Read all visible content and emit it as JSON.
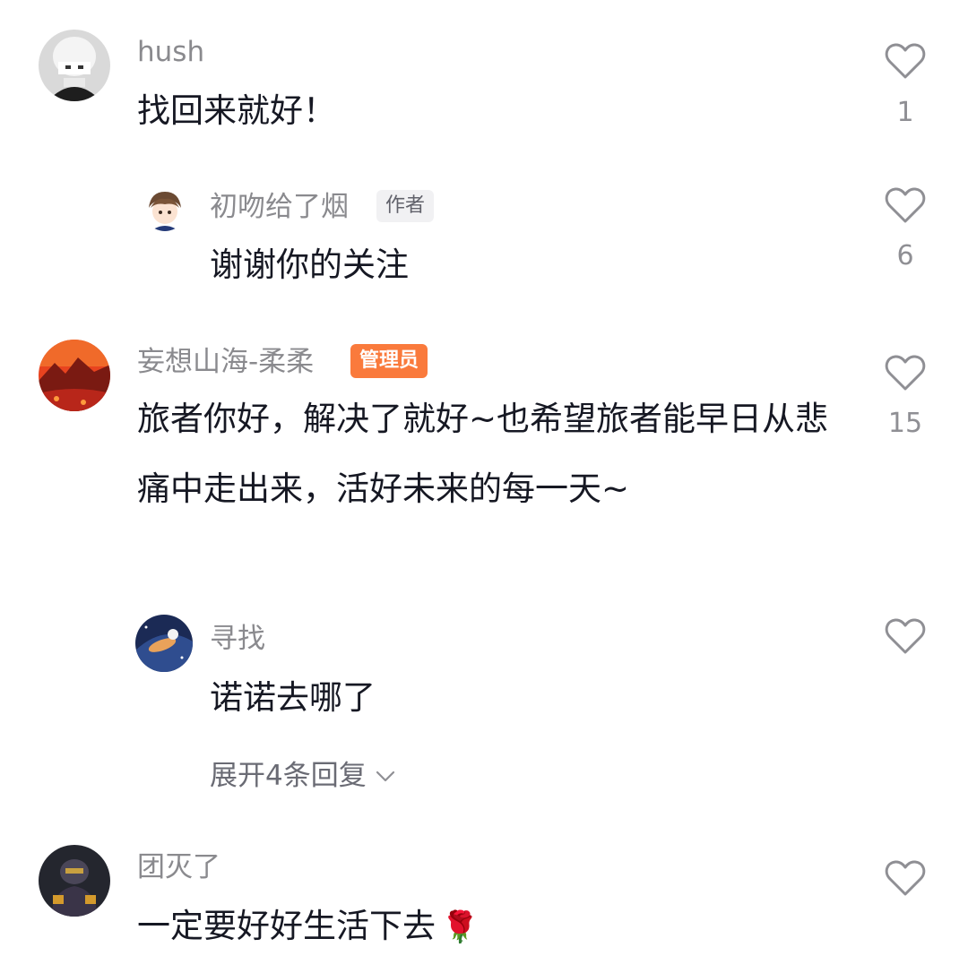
{
  "comments": [
    {
      "username": "hush",
      "text": "找回来就好！",
      "likes": "1",
      "avatar": "white-haired-anime-avatar"
    },
    {
      "username": "初吻给了烟",
      "badge": "作者",
      "text": "谢谢你的关注",
      "likes": "6",
      "avatar": "cartoon-boy-avatar"
    },
    {
      "username": "妄想山海-柔柔",
      "badge": "管理员",
      "text": "旅者你好，解决了就好~也希望旅者能早日从悲痛中走出来，活好未来的每一天~",
      "likes": "15",
      "avatar": "red-landscape-avatar"
    },
    {
      "username": "寻找",
      "text": "诺诺去哪了",
      "avatar": "blue-galaxy-avatar",
      "expand_label": "展开4条回复"
    },
    {
      "username": "团灭了",
      "text": "一定要好好生活下去",
      "emoji": "🌹",
      "avatar": "dark-character-avatar"
    }
  ],
  "colors": {
    "admin_badge": "#fa7a3c",
    "username": "#8a8a8e",
    "text": "#161823"
  },
  "icons": {
    "like": "heart-outline-icon",
    "expand": "chevron-down-icon"
  }
}
